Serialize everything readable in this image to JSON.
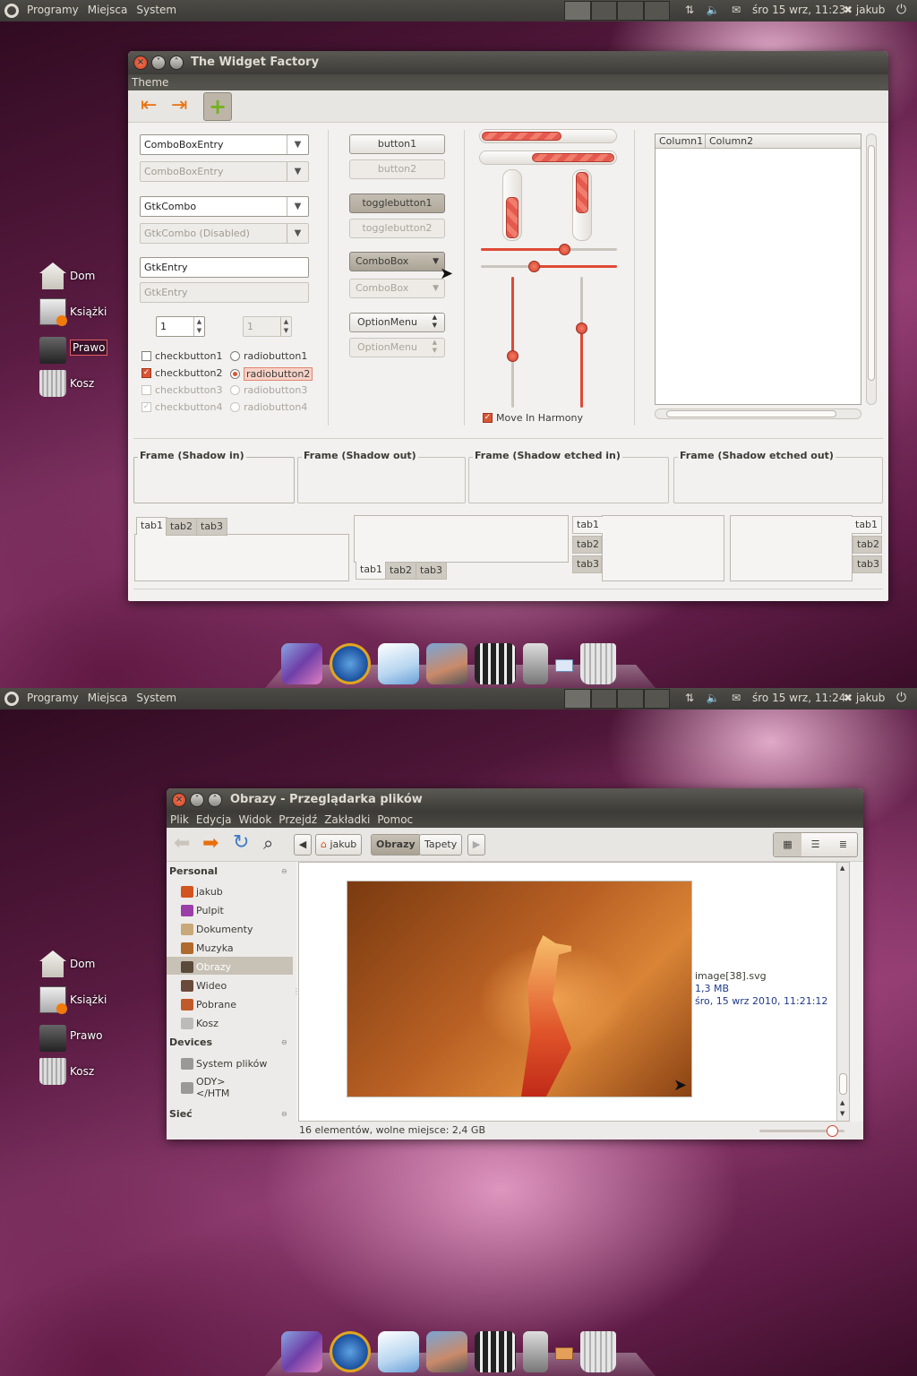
{
  "panel": {
    "menu_apps": "Programy",
    "menu_places": "Miejsca",
    "menu_system": "System",
    "user": "jakub"
  },
  "panel1": {
    "clock": "śro 15 wrz, 11:23"
  },
  "panel2": {
    "clock": "śro 15 wrz, 11:24"
  },
  "desktop": {
    "icons": [
      {
        "label": "Dom",
        "icon": "home-folder-icon"
      },
      {
        "label": "Książki",
        "icon": "books-feed-icon"
      },
      {
        "label": "Prawo",
        "icon": "printer-icon"
      },
      {
        "label": "Kosz",
        "icon": "trash-icon"
      }
    ]
  },
  "widget_factory": {
    "title": "The Widget Factory",
    "menu_theme": "Theme",
    "combo_entry": "ComboBoxEntry",
    "combo_entry_dis": "ComboBoxEntry",
    "gtk_combo": "GtkCombo",
    "gtk_combo_dis": "GtkCombo (Disabled)",
    "entry": "GtkEntry",
    "entry_dis": "GtkEntry",
    "spin": "1",
    "spin_dis": "1",
    "check1": "checkbutton1",
    "check2": "checkbutton2",
    "check3": "checkbutton3",
    "check4": "checkbutton4",
    "radio1": "radiobutton1",
    "radio2": "radiobutton2",
    "radio3": "radiobutton3",
    "radio4": "radiobutton4",
    "button1": "button1",
    "button2": "button2",
    "toggle1": "togglebutton1",
    "toggle2": "togglebutton2",
    "combobox": "ComboBox",
    "combobox_dis": "ComboBox",
    "optionmenu": "OptionMenu",
    "optionmenu_dis": "OptionMenu",
    "progress_h1": 0.6,
    "progress_h2": 0.62,
    "progress_v1": 0.6,
    "progress_v2": 0.6,
    "hscale1": 0.61,
    "hscale2": 0.39,
    "vscale1": 0.6,
    "vscale2": 0.39,
    "harmony": "Move In Harmony",
    "col1": "Column1",
    "col2": "Column2",
    "frames": [
      "Frame (Shadow in)",
      "Frame (Shadow out)",
      "Frame (Shadow etched in)",
      "Frame (Shadow etched out)"
    ],
    "tabs": [
      "tab1",
      "tab2",
      "tab3"
    ]
  },
  "nautilus": {
    "title": "Obrazy - Przeglądarka plików",
    "menus": [
      "Plik",
      "Edycja",
      "Widok",
      "Przejdź",
      "Zakładki",
      "Pomoc"
    ],
    "path": [
      "jakub",
      "Obrazy",
      "Tapety"
    ],
    "sidebar": {
      "personal": "Personal",
      "personal_items": [
        "jakub",
        "Pulpit",
        "Dokumenty",
        "Muzyka",
        "Obrazy",
        "Wideo",
        "Pobrane",
        "Kosz"
      ],
      "devices": "Devices",
      "device_items": [
        "System plików",
        "ODY>\n</HTM"
      ],
      "network": "Sieć"
    },
    "file": {
      "name": "image[38].svg",
      "size": "1,3 MB",
      "date": "śro, 15 wrz 2010, 11:21:12"
    },
    "status": "16 elementów, wolne miejsce: 2,4 GB",
    "zoom": 0.85
  }
}
